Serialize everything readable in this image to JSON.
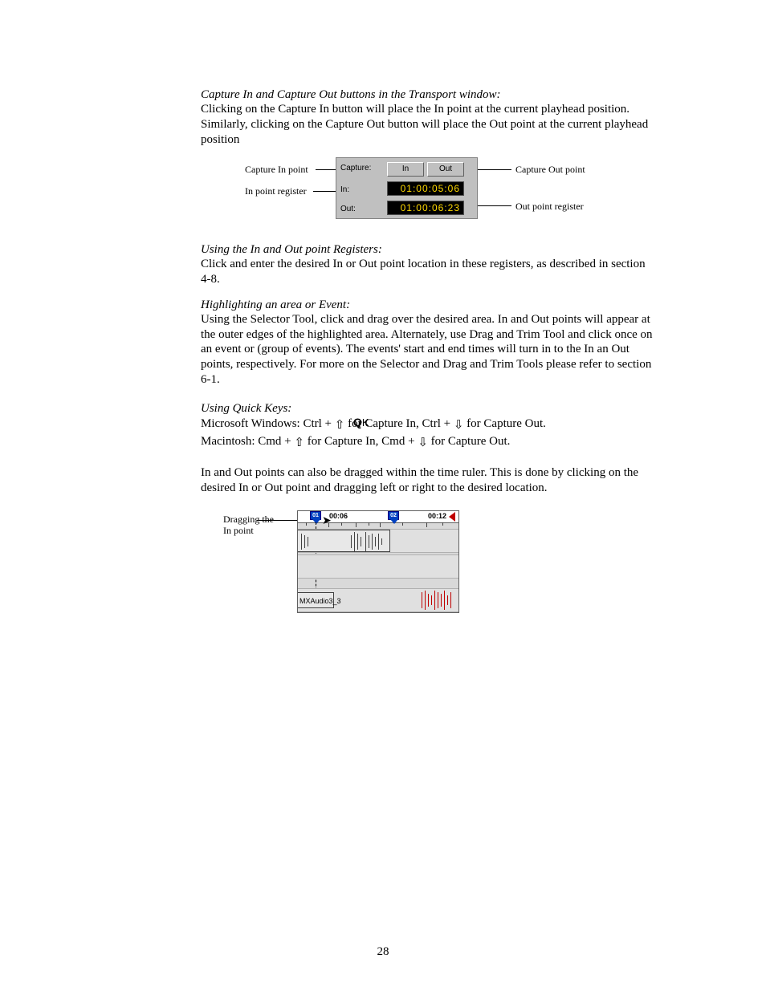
{
  "section1": {
    "heading": "Capture In and Capture Out buttons in the Transport window:",
    "body": "Clicking on the Capture In button will place the In point at the current playhead position. Similarly, clicking on the Capture Out button will place the Out point at the current playhead position"
  },
  "fig1": {
    "label_capture_in": "Capture In point",
    "label_in_register": "In point register",
    "label_capture_out": "Capture Out point",
    "label_out_register": "Out point register",
    "capture_label": "Capture:",
    "in_button": "In",
    "out_button": "Out",
    "in_label": "In:",
    "out_label": "Out:",
    "in_time": "01:00:05:06",
    "out_time": "01:00:06:23"
  },
  "section2": {
    "heading": "Using the In and Out point Registers:",
    "body": "Click and enter the desired In or Out point location in these registers, as described in section 4-8."
  },
  "section3": {
    "heading": "Highlighting an area or Event:",
    "body": "Using the Selector Tool, click and drag over the desired area. In and Out points will appear at the outer edges of the highlighted area. Alternately, use Drag and Trim Tool and click once on an event or (group of events). The events' start and end times will turn in to the In an Out points, respectively. For more on the Selector and Drag and Trim Tools please refer to section 6-1."
  },
  "section4": {
    "heading": "Using Quick Keys:",
    "win_prefix": "Microsoft Windows: Ctrl + ",
    "win_mid": " for Capture In,  Ctrl + ",
    "win_suffix": "  for Capture Out.",
    "mac_prefix": "Macintosh: Cmd + ",
    "mac_mid": " for Capture In,  Cmd + ",
    "mac_suffix": "  for Capture Out.",
    "drag_body": "In and Out points can also be dragged within the time ruler. This is done by clicking on the desired In or Out point and dragging left or right to the desired location."
  },
  "qk_marker": {
    "q": "Q",
    "k": "K"
  },
  "fig2": {
    "label_line1": "Dragging the",
    "label_line2": "In point",
    "marker1": "01",
    "marker2": "02",
    "time1": "00:06",
    "time2": "00:12",
    "clip_name": "MXAudio3_3"
  },
  "page_number": "28"
}
